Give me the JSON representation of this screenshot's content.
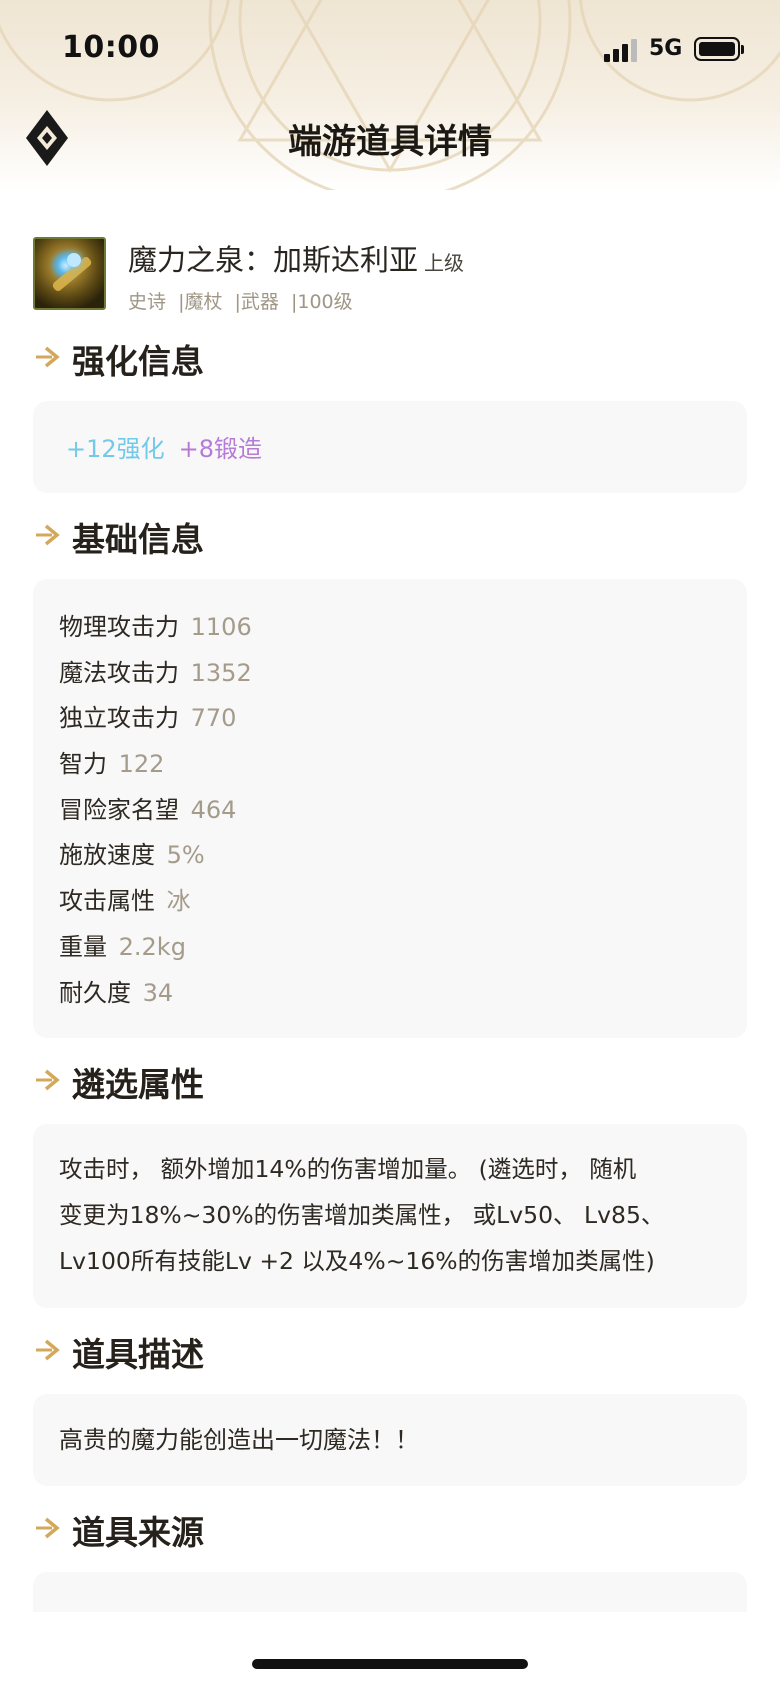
{
  "status_bar": {
    "time": "10:00",
    "network": "5G"
  },
  "nav": {
    "title": "端游道具详情",
    "back_icon": "diamond-logo-back-icon"
  },
  "item": {
    "name": "魔力之泉：加斯达利亚",
    "grade": "上级",
    "tags": [
      "史诗",
      "|魔杖",
      "|武器",
      "|100级"
    ]
  },
  "sections": {
    "enhance": {
      "title": "强化信息",
      "enhance_text": "+12强化",
      "forge_text": "+8锻造",
      "colors": {
        "enhance": "#72c9e8",
        "forge": "#b67ad8"
      }
    },
    "basic": {
      "title": "基础信息",
      "stats": [
        {
          "label": "物理攻击力",
          "value": "1106"
        },
        {
          "label": "魔法攻击力",
          "value": "1352"
        },
        {
          "label": "独立攻击力",
          "value": "770"
        },
        {
          "label": "智力",
          "value": "122"
        },
        {
          "label": "冒险家名望",
          "value": "464"
        },
        {
          "label": "施放速度",
          "value": "5%"
        },
        {
          "label": "攻击属性",
          "value": "冰"
        },
        {
          "label": "重量",
          "value": "2.2kg"
        },
        {
          "label": "耐久度",
          "value": "34"
        }
      ]
    },
    "select_attr": {
      "title": "遴选属性",
      "lines": [
        "攻击时， 额外增加14%的伤害增加量。 (遴选时， 随机",
        "变更为18%~30%的伤害增加类属性， 或Lv50、 Lv85、",
        "Lv100所有技能Lv +2 以及4%~16%的伤害增加类属性)"
      ]
    },
    "description": {
      "title": "道具描述",
      "text": "高贵的魔力能创造出一切魔法！！"
    },
    "source": {
      "title": "道具来源"
    }
  },
  "theme": {
    "accent": "#d4a85a",
    "value_gray": "#a59b8b"
  }
}
